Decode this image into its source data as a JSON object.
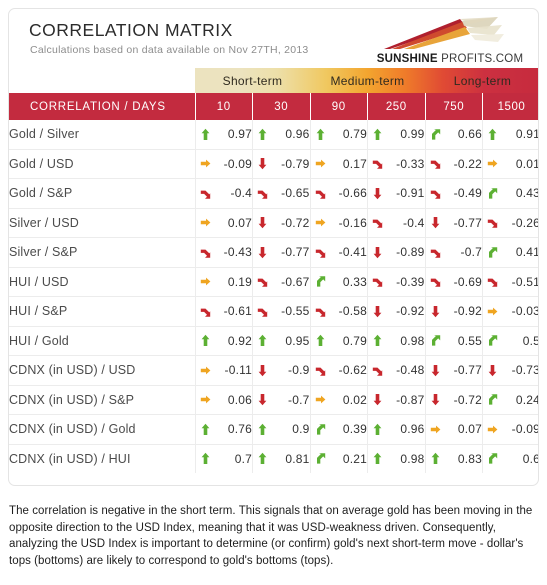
{
  "header": {
    "title": "CORRELATION MATRIX",
    "subtitle": "Calculations based on data available on Nov 27TH, 2013",
    "logo": {
      "brand_bold": "SUNSHINE",
      "brand_rest": " PROFITS.COM",
      "icon": "sunburst-rays-logo"
    }
  },
  "table": {
    "bands": [
      {
        "label": "Short-term"
      },
      {
        "label": "Medium-term"
      },
      {
        "label": "Long-term"
      }
    ],
    "corner_header": "CORRELATION / DAYS",
    "columns": [
      "10",
      "30",
      "90",
      "250",
      "750",
      "1500"
    ],
    "rows": [
      {
        "label": "Gold / Silver",
        "cells": [
          {
            "value": "0.97",
            "arrow": "up-arrow-green",
            "color": "#5cb033"
          },
          {
            "value": "0.96",
            "arrow": "up-arrow-green",
            "color": "#5cb033"
          },
          {
            "value": "0.79",
            "arrow": "up-arrow-green",
            "color": "#5cb033"
          },
          {
            "value": "0.99",
            "arrow": "up-arrow-green",
            "color": "#5cb033"
          },
          {
            "value": "0.66",
            "arrow": "diagonal-up-arrow-green",
            "color": "#5cb033"
          },
          {
            "value": "0.91",
            "arrow": "up-arrow-green",
            "color": "#5cb033"
          }
        ]
      },
      {
        "label": "Gold / USD",
        "cells": [
          {
            "value": "-0.09",
            "arrow": "right-arrow-orange",
            "color": "#efa521"
          },
          {
            "value": "-0.79",
            "arrow": "down-arrow-red",
            "color": "#c8272d"
          },
          {
            "value": "0.17",
            "arrow": "right-arrow-orange",
            "color": "#efa521"
          },
          {
            "value": "-0.33",
            "arrow": "diagonal-down-arrow-red",
            "color": "#c8272d"
          },
          {
            "value": "-0.22",
            "arrow": "diagonal-down-arrow-red",
            "color": "#c8272d"
          },
          {
            "value": "0.01",
            "arrow": "right-arrow-orange",
            "color": "#efa521"
          }
        ]
      },
      {
        "label": "Gold / S&P",
        "cells": [
          {
            "value": "-0.4",
            "arrow": "diagonal-down-arrow-red",
            "color": "#c8272d"
          },
          {
            "value": "-0.65",
            "arrow": "diagonal-down-arrow-red",
            "color": "#c8272d"
          },
          {
            "value": "-0.66",
            "arrow": "diagonal-down-arrow-red",
            "color": "#c8272d"
          },
          {
            "value": "-0.91",
            "arrow": "down-arrow-red",
            "color": "#c8272d"
          },
          {
            "value": "-0.49",
            "arrow": "diagonal-down-arrow-red",
            "color": "#c8272d"
          },
          {
            "value": "0.43",
            "arrow": "diagonal-up-arrow-green",
            "color": "#5cb033"
          }
        ]
      },
      {
        "label": "Silver / USD",
        "cells": [
          {
            "value": "0.07",
            "arrow": "right-arrow-orange",
            "color": "#efa521"
          },
          {
            "value": "-0.72",
            "arrow": "down-arrow-red",
            "color": "#c8272d"
          },
          {
            "value": "-0.16",
            "arrow": "right-arrow-orange",
            "color": "#efa521"
          },
          {
            "value": "-0.4",
            "arrow": "diagonal-down-arrow-red",
            "color": "#c8272d"
          },
          {
            "value": "-0.77",
            "arrow": "down-arrow-red",
            "color": "#c8272d"
          },
          {
            "value": "-0.26",
            "arrow": "diagonal-down-arrow-red",
            "color": "#c8272d"
          }
        ]
      },
      {
        "label": "Silver / S&P",
        "cells": [
          {
            "value": "-0.43",
            "arrow": "diagonal-down-arrow-red",
            "color": "#c8272d"
          },
          {
            "value": "-0.77",
            "arrow": "down-arrow-red",
            "color": "#c8272d"
          },
          {
            "value": "-0.41",
            "arrow": "diagonal-down-arrow-red",
            "color": "#c8272d"
          },
          {
            "value": "-0.89",
            "arrow": "down-arrow-red",
            "color": "#c8272d"
          },
          {
            "value": "-0.7",
            "arrow": "diagonal-down-arrow-red",
            "color": "#c8272d"
          },
          {
            "value": "0.41",
            "arrow": "diagonal-up-arrow-green",
            "color": "#5cb033"
          }
        ]
      },
      {
        "label": "HUI / USD",
        "cells": [
          {
            "value": "0.19",
            "arrow": "right-arrow-orange",
            "color": "#efa521"
          },
          {
            "value": "-0.67",
            "arrow": "diagonal-down-arrow-red",
            "color": "#c8272d"
          },
          {
            "value": "0.33",
            "arrow": "diagonal-up-arrow-green",
            "color": "#5cb033"
          },
          {
            "value": "-0.39",
            "arrow": "diagonal-down-arrow-red",
            "color": "#c8272d"
          },
          {
            "value": "-0.69",
            "arrow": "diagonal-down-arrow-red",
            "color": "#c8272d"
          },
          {
            "value": "-0.51",
            "arrow": "diagonal-down-arrow-red",
            "color": "#c8272d"
          }
        ]
      },
      {
        "label": "HUI / S&P",
        "cells": [
          {
            "value": "-0.61",
            "arrow": "diagonal-down-arrow-red",
            "color": "#c8272d"
          },
          {
            "value": "-0.55",
            "arrow": "diagonal-down-arrow-red",
            "color": "#c8272d"
          },
          {
            "value": "-0.58",
            "arrow": "diagonal-down-arrow-red",
            "color": "#c8272d"
          },
          {
            "value": "-0.92",
            "arrow": "down-arrow-red",
            "color": "#c8272d"
          },
          {
            "value": "-0.92",
            "arrow": "down-arrow-red",
            "color": "#c8272d"
          },
          {
            "value": "-0.03",
            "arrow": "right-arrow-orange",
            "color": "#efa521"
          }
        ]
      },
      {
        "label": "HUI / Gold",
        "cells": [
          {
            "value": "0.92",
            "arrow": "up-arrow-green",
            "color": "#5cb033"
          },
          {
            "value": "0.95",
            "arrow": "up-arrow-green",
            "color": "#5cb033"
          },
          {
            "value": "0.79",
            "arrow": "up-arrow-green",
            "color": "#5cb033"
          },
          {
            "value": "0.98",
            "arrow": "up-arrow-green",
            "color": "#5cb033"
          },
          {
            "value": "0.55",
            "arrow": "diagonal-up-arrow-green",
            "color": "#5cb033"
          },
          {
            "value": "0.5",
            "arrow": "diagonal-up-arrow-green",
            "color": "#5cb033"
          }
        ]
      },
      {
        "label": "CDNX (in USD) / USD",
        "cells": [
          {
            "value": "-0.11",
            "arrow": "right-arrow-orange",
            "color": "#efa521"
          },
          {
            "value": "-0.9",
            "arrow": "down-arrow-red",
            "color": "#c8272d"
          },
          {
            "value": "-0.62",
            "arrow": "diagonal-down-arrow-red",
            "color": "#c8272d"
          },
          {
            "value": "-0.48",
            "arrow": "diagonal-down-arrow-red",
            "color": "#c8272d"
          },
          {
            "value": "-0.77",
            "arrow": "down-arrow-red",
            "color": "#c8272d"
          },
          {
            "value": "-0.73",
            "arrow": "down-arrow-red",
            "color": "#c8272d"
          }
        ]
      },
      {
        "label": "CDNX (in USD) / S&P",
        "cells": [
          {
            "value": "0.06",
            "arrow": "right-arrow-orange",
            "color": "#efa521"
          },
          {
            "value": "-0.7",
            "arrow": "down-arrow-red",
            "color": "#c8272d"
          },
          {
            "value": "0.02",
            "arrow": "right-arrow-orange",
            "color": "#efa521"
          },
          {
            "value": "-0.87",
            "arrow": "down-arrow-red",
            "color": "#c8272d"
          },
          {
            "value": "-0.72",
            "arrow": "down-arrow-red",
            "color": "#c8272d"
          },
          {
            "value": "0.24",
            "arrow": "diagonal-up-arrow-green",
            "color": "#5cb033"
          }
        ]
      },
      {
        "label": "CDNX (in USD) / Gold",
        "cells": [
          {
            "value": "0.76",
            "arrow": "up-arrow-green",
            "color": "#5cb033"
          },
          {
            "value": "0.9",
            "arrow": "up-arrow-green",
            "color": "#5cb033"
          },
          {
            "value": "0.39",
            "arrow": "diagonal-up-arrow-green",
            "color": "#5cb033"
          },
          {
            "value": "0.96",
            "arrow": "up-arrow-green",
            "color": "#5cb033"
          },
          {
            "value": "0.07",
            "arrow": "right-arrow-orange",
            "color": "#efa521"
          },
          {
            "value": "-0.09",
            "arrow": "right-arrow-orange",
            "color": "#efa521"
          }
        ]
      },
      {
        "label": "CDNX (in USD) / HUI",
        "cells": [
          {
            "value": "0.7",
            "arrow": "up-arrow-green",
            "color": "#5cb033"
          },
          {
            "value": "0.81",
            "arrow": "up-arrow-green",
            "color": "#5cb033"
          },
          {
            "value": "0.21",
            "arrow": "diagonal-up-arrow-green",
            "color": "#5cb033"
          },
          {
            "value": "0.98",
            "arrow": "up-arrow-green",
            "color": "#5cb033"
          },
          {
            "value": "0.83",
            "arrow": "up-arrow-green",
            "color": "#5cb033"
          },
          {
            "value": "0.6",
            "arrow": "diagonal-up-arrow-green",
            "color": "#5cb033"
          }
        ]
      }
    ]
  },
  "footer": {
    "text": "The correlation is negative in the short term. This signals that on average gold has been moving in the opposite direction to the USD Index, meaning that it was USD-weakness driven. Consequently, analyzing the USD Index is important to determine (or confirm) gold's next short-term move - dollar's tops (bottoms) are likely to correspond to gold's bottoms (tops)."
  },
  "colors": {
    "header_red": "#c32b3f",
    "positive_green": "#5cb033",
    "neutral_orange": "#efa521",
    "negative_red": "#c8272d",
    "band_start": "#ece3bf",
    "band_end": "#c62b3e"
  },
  "chart_data": {
    "type": "heatmap",
    "title": "CORRELATION MATRIX",
    "subtitle": "Calculations based on data available on Nov 27TH, 2013",
    "xlabel": "CORRELATION / DAYS",
    "ylabel": "",
    "x": [
      "10",
      "30",
      "90",
      "250",
      "750",
      "1500"
    ],
    "x_groups": [
      {
        "label": "Short-term",
        "columns": [
          "10",
          "30"
        ]
      },
      {
        "label": "Medium-term",
        "columns": [
          "90",
          "250"
        ]
      },
      {
        "label": "Long-term",
        "columns": [
          "750",
          "1500"
        ]
      }
    ],
    "y": [
      "Gold / Silver",
      "Gold / USD",
      "Gold / S&P",
      "Silver / USD",
      "Silver / S&P",
      "HUI / USD",
      "HUI / S&P",
      "HUI / Gold",
      "CDNX (in USD) / USD",
      "CDNX (in USD) / S&P",
      "CDNX (in USD) / Gold",
      "CDNX (in USD) / HUI"
    ],
    "values": [
      [
        0.97,
        0.96,
        0.79,
        0.99,
        0.66,
        0.91
      ],
      [
        -0.09,
        -0.79,
        0.17,
        -0.33,
        -0.22,
        0.01
      ],
      [
        -0.4,
        -0.65,
        -0.66,
        -0.91,
        -0.49,
        0.43
      ],
      [
        0.07,
        -0.72,
        -0.16,
        -0.4,
        -0.77,
        -0.26
      ],
      [
        -0.43,
        -0.77,
        -0.41,
        -0.89,
        -0.7,
        0.41
      ],
      [
        0.19,
        -0.67,
        0.33,
        -0.39,
        -0.69,
        -0.51
      ],
      [
        -0.61,
        -0.55,
        -0.58,
        -0.92,
        -0.92,
        -0.03
      ],
      [
        0.92,
        0.95,
        0.79,
        0.98,
        0.55,
        0.5
      ],
      [
        -0.11,
        -0.9,
        -0.62,
        -0.48,
        -0.77,
        -0.73
      ],
      [
        0.06,
        -0.7,
        0.02,
        -0.87,
        -0.72,
        0.24
      ],
      [
        0.76,
        0.9,
        0.39,
        0.96,
        0.07,
        -0.09
      ],
      [
        0.7,
        0.81,
        0.21,
        0.98,
        0.83,
        0.6
      ]
    ],
    "zlim": [
      -1,
      1
    ],
    "grid": true,
    "legend": "none",
    "annotation": "The correlation is negative in the short term. This signals that on average gold has been moving in the opposite direction to the USD Index, meaning that it was USD-weakness driven. Consequently, analyzing the USD Index is important to determine (or confirm) gold's next short-term move - dollar's tops (bottoms) are likely to correspond to gold's bottoms (tops)."
  }
}
